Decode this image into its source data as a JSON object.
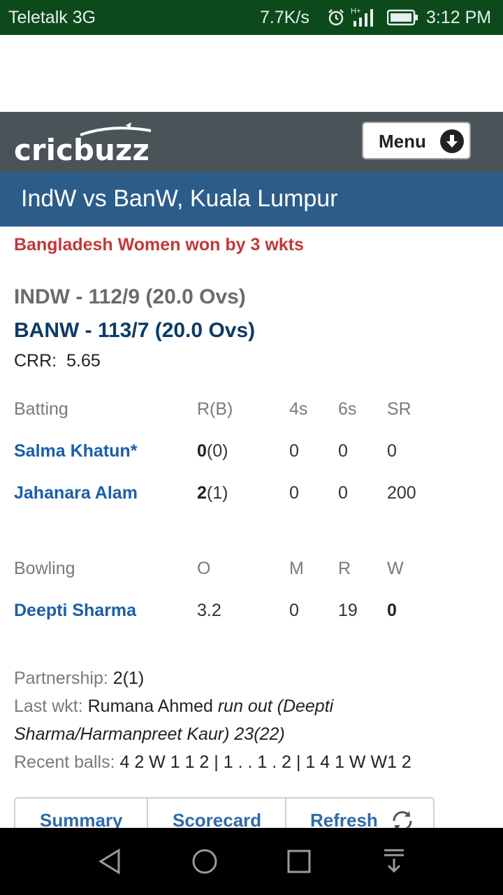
{
  "status_bar": {
    "carrier": "Teletalk 3G",
    "speed": "7.7K/s",
    "time": "3:12 PM",
    "icons": [
      "alarm-icon",
      "signal-icon",
      "battery-icon"
    ]
  },
  "header": {
    "logo_text": "cricbuzz",
    "menu_label": "Menu",
    "menu_icon": "down-arrow-circle-icon",
    "bar_color": "#4a5458"
  },
  "match": {
    "title": "IndW vs BanW, Kuala Lumpur",
    "result": "Bangladesh Women won by 3 wkts",
    "innings": [
      "INDW - 112/9 (20.0 Ovs)",
      "BANW - 113/7 (20.0 Ovs)"
    ],
    "crr_label": "CRR:",
    "crr_value": "5.65"
  },
  "batting": {
    "headers": [
      "Batting",
      "R(B)",
      "4s",
      "6s",
      "SR"
    ],
    "rows": [
      {
        "name": "Salma Khatun*",
        "runs": "0",
        "balls": "(0)",
        "fours": "0",
        "sixes": "0",
        "sr": "0"
      },
      {
        "name": "Jahanara Alam",
        "runs": "2",
        "balls": "(1)",
        "fours": "0",
        "sixes": "0",
        "sr": "200"
      }
    ]
  },
  "bowling": {
    "headers": [
      "Bowling",
      "O",
      "M",
      "R",
      "W"
    ],
    "rows": [
      {
        "name": "Deepti Sharma",
        "overs": "3.2",
        "maidens": "0",
        "runs": "19",
        "wickets": "0"
      }
    ]
  },
  "details": {
    "partnership_label": "Partnership:",
    "partnership_value": "2(1)",
    "last_wkt_label": "Last wkt:",
    "last_wkt_batter": "Rumana Ahmed",
    "last_wkt_line1": "run out (Deepti",
    "last_wkt_line2": "Sharma/Harmanpreet Kaur) 23(22)",
    "recent_label": "Recent balls:",
    "recent_value": "4 2 W 1 1 2 | 1 . . 1 . 2 | 1 4 1 W W1 2"
  },
  "buttons": {
    "summary": "Summary",
    "scorecard": "Scorecard",
    "refresh": "Refresh"
  },
  "colors": {
    "title_bar": "#2c5d8a",
    "result": "#c0383b",
    "player_link": "#1a5fa8",
    "status_bar": "#0c4a1c"
  }
}
